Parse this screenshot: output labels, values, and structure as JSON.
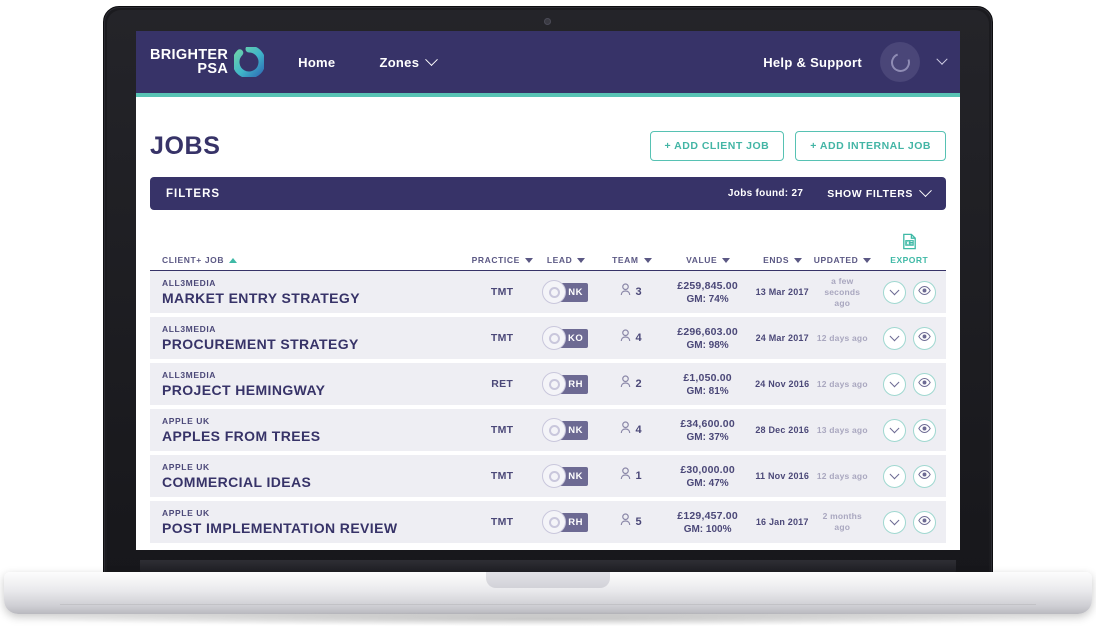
{
  "brand": {
    "line1": "BRIGHTER",
    "line2": "PSA",
    "logo_icon": "brighter-psa-ring-logo"
  },
  "nav": {
    "home": "Home",
    "zones": "Zones",
    "zones_caret_icon": "chevron-down-icon",
    "help": "Help & Support",
    "avatar_icon": "user-avatar-icon",
    "account_caret_icon": "chevron-down-icon"
  },
  "page": {
    "title": "JOBS",
    "add_client_job": "+ ADD CLIENT JOB",
    "add_internal_job": "+ ADD INTERNAL JOB"
  },
  "filters": {
    "label": "FILTERS",
    "jobs_found": "Jobs found: 27",
    "show_filters": "SHOW FILTERS",
    "show_filters_caret_icon": "chevron-down-icon"
  },
  "table": {
    "headers": {
      "job": "CLIENT+ JOB",
      "practice": "PRACTICE",
      "lead": "LEAD",
      "team": "TEAM",
      "value": "VALUE",
      "ends": "ENDS",
      "updated": "UPDATED",
      "export": "EXPORT"
    },
    "sort": {
      "column": "CLIENT+ JOB",
      "direction": "asc"
    },
    "rows": [
      {
        "client": "ALL3MEDIA",
        "job": "MARKET ENTRY STRATEGY",
        "practice": "TMT",
        "lead_initials": "NK",
        "team": "3",
        "value": "£259,845.00",
        "gm": "GM: 74%",
        "ends": "13 Mar 2017",
        "updated": "a few seconds ago"
      },
      {
        "client": "ALL3MEDIA",
        "job": "PROCUREMENT STRATEGY",
        "practice": "TMT",
        "lead_initials": "KO",
        "team": "4",
        "value": "£296,603.00",
        "gm": "GM: 98%",
        "ends": "24 Mar 2017",
        "updated": "12 days ago"
      },
      {
        "client": "ALL3MEDIA",
        "job": "PROJECT HEMINGWAY",
        "practice": "RET",
        "lead_initials": "RH",
        "team": "2",
        "value": "£1,050.00",
        "gm": "GM: 81%",
        "ends": "24 Nov 2016",
        "updated": "12 days ago"
      },
      {
        "client": "APPLE UK",
        "job": "APPLES FROM TREES",
        "practice": "TMT",
        "lead_initials": "NK",
        "team": "4",
        "value": "£34,600.00",
        "gm": "GM: 37%",
        "ends": "28 Dec 2016",
        "updated": "13 days ago"
      },
      {
        "client": "APPLE UK",
        "job": "COMMERCIAL IDEAS",
        "practice": "TMT",
        "lead_initials": "NK",
        "team": "1",
        "value": "£30,000.00",
        "gm": "GM: 47%",
        "ends": "11 Nov 2016",
        "updated": "12 days ago"
      },
      {
        "client": "APPLE UK",
        "job": "POST IMPLEMENTATION REVIEW",
        "practice": "TMT",
        "lead_initials": "RH",
        "team": "5",
        "value": "£129,457.00",
        "gm": "GM: 100%",
        "ends": "16 Jan 2017",
        "updated": "2 months ago"
      }
    ],
    "row_actions": {
      "expand_icon": "chevron-down-icon",
      "view_icon": "eye-icon"
    }
  },
  "colors": {
    "navy": "#373368",
    "teal": "#58c3b4",
    "row_bg": "#eeeef3",
    "muted": "#a9a7bf"
  }
}
